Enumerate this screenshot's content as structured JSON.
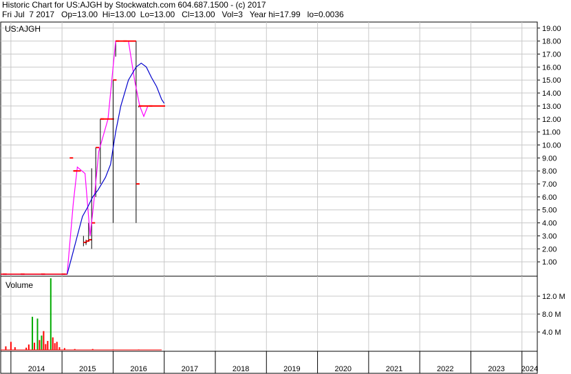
{
  "header": {
    "title": "Historic Chart for US:AJGH by Stockwatch.com 604.687.1500 - (c) 2017",
    "info": "Fri Jul  7 2017   Op=13.00  Hi=13.00  Lo=13.00   Cl=13.00   Vol=3   Year hi=17.99   lo=0.0036"
  },
  "colors": {
    "price_bar": "#ff0000",
    "short_ma": "#ff00ff",
    "long_ma": "#0000cc",
    "volume_up": "#00aa00",
    "volume_down": "#ff0000",
    "grid": "#c8c8c8"
  },
  "chart_data": [
    {
      "type": "line",
      "panel_label": "US:AJGH",
      "y_ticks": [
        "1.00",
        "2.00",
        "3.00",
        "4.00",
        "5.00",
        "6.00",
        "7.00",
        "8.00",
        "9.00",
        "10.00",
        "11.00",
        "12.00",
        "13.00",
        "14.00",
        "15.00",
        "16.00",
        "17.00",
        "18.00",
        "19.00"
      ],
      "ylim": [
        0,
        19.2
      ],
      "xlim": [
        2013.8,
        2024.3
      ],
      "x_ticks": [
        "2014",
        "2015",
        "2016",
        "2017",
        "2018",
        "2019",
        "2020",
        "2021",
        "2022",
        "2023",
        "2024"
      ],
      "grid": true,
      "series": [
        {
          "key": "price",
          "style": "hlc_bars",
          "points": [
            {
              "x": 2013.85,
              "hi": 0.1,
              "lo": 0.0,
              "cl": 0.05
            },
            {
              "x": 2014.2,
              "hi": 0.1,
              "lo": 0.0,
              "cl": 0.05
            },
            {
              "x": 2014.6,
              "hi": 0.1,
              "lo": 0.0,
              "cl": 0.05
            },
            {
              "x": 2015.0,
              "hi": 0.1,
              "lo": 0.0,
              "cl": 0.05
            },
            {
              "x": 2015.15,
              "hi": 9.0,
              "lo": 9.0,
              "cl": 9.0
            },
            {
              "x": 2015.22,
              "hi": 8.0,
              "lo": 8.0,
              "cl": 8.0
            },
            {
              "x": 2015.3,
              "hi": 8.0,
              "lo": 8.0,
              "cl": 8.0
            },
            {
              "x": 2015.42,
              "hi": 3.0,
              "lo": 2.2,
              "cl": 2.5
            },
            {
              "x": 2015.47,
              "hi": 2.7,
              "lo": 2.3,
              "cl": 2.6
            },
            {
              "x": 2015.52,
              "hi": 4.0,
              "lo": 2.6,
              "cl": 2.7
            },
            {
              "x": 2015.58,
              "hi": 8.2,
              "lo": 2.0,
              "cl": 4.0
            },
            {
              "x": 2015.66,
              "hi": 9.8,
              "lo": 6.0,
              "cl": 9.8
            },
            {
              "x": 2015.75,
              "hi": 12.0,
              "lo": 7.0,
              "cl": 12.0
            },
            {
              "x": 2015.95,
              "hi": 12.0,
              "lo": 12.0,
              "cl": 12.0
            },
            {
              "x": 2016.0,
              "hi": 15.0,
              "lo": 4.0,
              "cl": 15.0
            },
            {
              "x": 2016.05,
              "hi": 18.0,
              "lo": 16.8,
              "cl": 18.0
            },
            {
              "x": 2016.2,
              "hi": 18.0,
              "lo": 18.0,
              "cl": 18.0
            },
            {
              "x": 2016.45,
              "hi": 18.0,
              "lo": 4.0,
              "cl": 7.0
            },
            {
              "x": 2016.5,
              "hi": 13.0,
              "lo": 12.9,
              "cl": 13.0
            },
            {
              "x": 2016.7,
              "hi": 13.0,
              "lo": 13.0,
              "cl": 13.0
            },
            {
              "x": 2016.95,
              "hi": 13.0,
              "lo": 13.0,
              "cl": 13.0
            }
          ]
        },
        {
          "key": "short_ma",
          "points": [
            [
              2013.8,
              0.05
            ],
            [
              2015.1,
              0.05
            ],
            [
              2015.22,
              5.5
            ],
            [
              2015.3,
              8.3
            ],
            [
              2015.45,
              7.8
            ],
            [
              2015.55,
              3.0
            ],
            [
              2015.62,
              5.5
            ],
            [
              2015.72,
              9.5
            ],
            [
              2015.9,
              12.0
            ],
            [
              2016.05,
              18.0
            ],
            [
              2016.15,
              18.0
            ],
            [
              2016.3,
              18.0
            ],
            [
              2016.42,
              15.0
            ],
            [
              2016.52,
              13.0
            ],
            [
              2016.6,
              12.2
            ],
            [
              2016.68,
              13.0
            ]
          ]
        },
        {
          "key": "long_ma",
          "points": [
            [
              2013.8,
              0.05
            ],
            [
              2015.1,
              0.05
            ],
            [
              2015.2,
              1.5
            ],
            [
              2015.3,
              3.0
            ],
            [
              2015.4,
              4.5
            ],
            [
              2015.5,
              5.2
            ],
            [
              2015.6,
              6.0
            ],
            [
              2015.7,
              6.5
            ],
            [
              2015.85,
              7.5
            ],
            [
              2015.95,
              8.5
            ],
            [
              2016.05,
              11.0
            ],
            [
              2016.15,
              13.0
            ],
            [
              2016.3,
              15.0
            ],
            [
              2016.45,
              16.0
            ],
            [
              2016.55,
              16.3
            ],
            [
              2016.65,
              16.0
            ],
            [
              2016.75,
              15.2
            ],
            [
              2016.85,
              14.5
            ],
            [
              2016.95,
              13.5
            ],
            [
              2017.0,
              13.2
            ]
          ]
        }
      ]
    },
    {
      "type": "bar",
      "panel_label": "Volume",
      "y_ticks": [
        "4.0 M",
        "8.0 M",
        "12.0 M"
      ],
      "ylim": [
        0,
        16
      ],
      "bars": [
        {
          "x": 2013.9,
          "value": 0.8,
          "dir": "down"
        },
        {
          "x": 2014.0,
          "value": 1.8,
          "dir": "down"
        },
        {
          "x": 2014.08,
          "value": 0.6,
          "dir": "down"
        },
        {
          "x": 2014.3,
          "value": 0.5,
          "dir": "down"
        },
        {
          "x": 2014.35,
          "value": 1.2,
          "dir": "down"
        },
        {
          "x": 2014.42,
          "value": 7.4,
          "dir": "up"
        },
        {
          "x": 2014.46,
          "value": 1.6,
          "dir": "down"
        },
        {
          "x": 2014.52,
          "value": 7.0,
          "dir": "up"
        },
        {
          "x": 2014.56,
          "value": 2.2,
          "dir": "down"
        },
        {
          "x": 2014.6,
          "value": 3.2,
          "dir": "up"
        },
        {
          "x": 2014.64,
          "value": 4.2,
          "dir": "down"
        },
        {
          "x": 2014.68,
          "value": 1.3,
          "dir": "down"
        },
        {
          "x": 2014.72,
          "value": 2.0,
          "dir": "down"
        },
        {
          "x": 2014.78,
          "value": 16.0,
          "dir": "up"
        },
        {
          "x": 2014.82,
          "value": 2.8,
          "dir": "down"
        },
        {
          "x": 2014.86,
          "value": 1.5,
          "dir": "down"
        },
        {
          "x": 2014.9,
          "value": 1.8,
          "dir": "down"
        },
        {
          "x": 2014.95,
          "value": 0.6,
          "dir": "down"
        },
        {
          "x": 2015.05,
          "value": 0.4,
          "dir": "down"
        },
        {
          "x": 2015.25,
          "value": 0.2,
          "dir": "down"
        },
        {
          "x": 2015.6,
          "value": 0.2,
          "dir": "down"
        },
        {
          "x": 2016.0,
          "value": 0.1,
          "dir": "down"
        },
        {
          "x": 2016.5,
          "value": 0.1,
          "dir": "down"
        }
      ]
    }
  ]
}
